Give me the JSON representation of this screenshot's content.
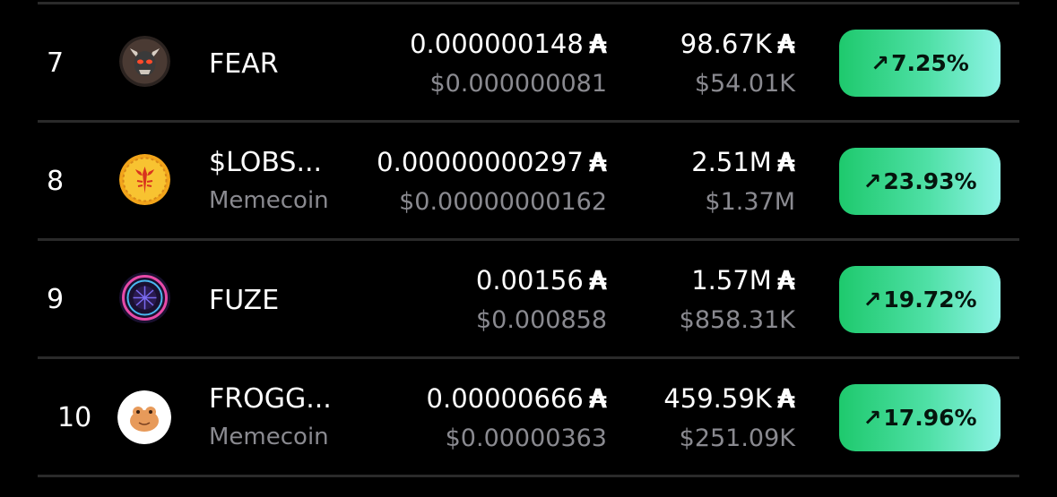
{
  "currency_symbol": "₳",
  "colors": {
    "background": "#000000",
    "divider": "#2a2a2a",
    "primary_text": "#ffffff",
    "secondary_text": "#8a8a90",
    "badge_gradient_start": "#1ec96d",
    "badge_gradient_end": "#8ef3e6"
  },
  "rows": [
    {
      "rank": "7",
      "name": "FEAR",
      "tag": "",
      "logo_icon": "horned-skull-icon",
      "price": "0.000000148",
      "price_usd": "$0.000000081",
      "market_cap": "98.67K",
      "market_cap_usd": "$54.01K",
      "change": "7.25%",
      "change_icon": "trend-up-arrow-icon"
    },
    {
      "rank": "8",
      "name": "$LOBS...",
      "tag": "Memecoin",
      "logo_icon": "lobster-coin-icon",
      "price": "0.00000000297",
      "price_usd": "$0.00000000162",
      "market_cap": "2.51M",
      "market_cap_usd": "$1.37M",
      "change": "23.93%",
      "change_icon": "trend-up-arrow-icon"
    },
    {
      "rank": "9",
      "name": "FUZE",
      "tag": "",
      "logo_icon": "neon-globe-icon",
      "price": "0.00156",
      "price_usd": "$0.000858",
      "market_cap": "1.57M",
      "market_cap_usd": "$858.31K",
      "change": "19.72%",
      "change_icon": "trend-up-arrow-icon"
    },
    {
      "rank": "10",
      "name": "FROGG...",
      "tag": "Memecoin",
      "logo_icon": "frog-mascot-icon",
      "price": "0.00000666",
      "price_usd": "$0.00000363",
      "market_cap": "459.59K",
      "market_cap_usd": "$251.09K",
      "change": "17.96%",
      "change_icon": "trend-up-arrow-icon"
    }
  ]
}
